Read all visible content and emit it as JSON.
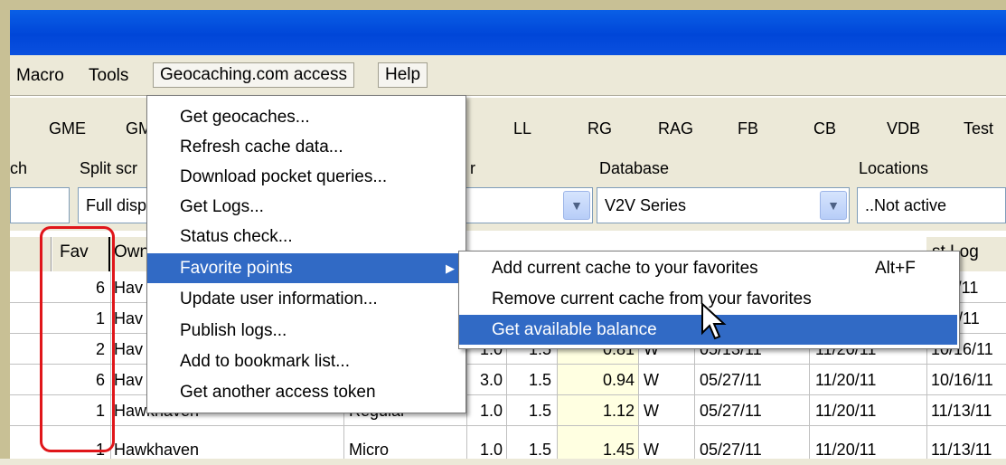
{
  "menubar": {
    "items": [
      "Macro",
      "Tools",
      "Geocaching.com access",
      "Help"
    ]
  },
  "toolbar": {
    "buttons": [
      "GME",
      "GM",
      "LL",
      "RG",
      "RAG",
      "FB",
      "CB",
      "VDB",
      "Test"
    ]
  },
  "filters": {
    "label_left": "ch",
    "split_label": "Split scr",
    "split_value": "Full disp",
    "filter_label_frag": "r",
    "database_label": "Database",
    "database_value": "V2V Series",
    "locations_label": "Locations",
    "locations_value": "..Not active"
  },
  "grid": {
    "headers": [
      "Fav",
      "Own",
      "",
      "",
      "",
      "",
      "",
      "",
      "",
      "st Log"
    ],
    "rows": [
      {
        "fav": "6",
        "owner": "Hav",
        "last": "11/11"
      },
      {
        "fav": "1",
        "owner": "Hav",
        "last": "16/11"
      },
      {
        "fav": "2",
        "owner": "Hav",
        "type": "",
        "d": "1.0",
        "t": "1.5",
        "dist": "0.81",
        "dir": "W",
        "placed": "05/13/11",
        "found": "11/20/11",
        "last": "10/16/11"
      },
      {
        "fav": "6",
        "owner": "Hav",
        "type": "",
        "d": "3.0",
        "t": "1.5",
        "dist": "0.94",
        "dir": "W",
        "placed": "05/27/11",
        "found": "11/20/11",
        "last": "10/16/11"
      },
      {
        "fav": "1",
        "owner": "Hawkhaven",
        "type": "Regular",
        "d": "1.0",
        "t": "1.5",
        "dist": "1.12",
        "dir": "W",
        "placed": "05/27/11",
        "found": "11/20/11",
        "last": "11/13/11"
      },
      {
        "fav": "1",
        "owner": "Hawkhaven",
        "type": "Micro",
        "d": "1.0",
        "t": "1.5",
        "dist": "1.45",
        "dir": "W",
        "placed": "05/27/11",
        "found": "11/20/11",
        "last": "11/13/11"
      }
    ]
  },
  "geocaching_menu": {
    "items": [
      "Get geocaches...",
      "Refresh cache data...",
      "Download pocket queries...",
      "Get Logs...",
      "Status check...",
      "Favorite points",
      "Update user information...",
      "Publish logs...",
      "Add to bookmark list...",
      "Get another access token"
    ]
  },
  "favorite_submenu": {
    "items": [
      {
        "label": "Add current cache to your favorites",
        "shortcut": "Alt+F"
      },
      {
        "label": "Remove current cache from your favorites",
        "shortcut": ""
      },
      {
        "label": "Get available balance",
        "shortcut": ""
      }
    ]
  },
  "colors": {
    "highlight": "#316ac5",
    "title_bar": "#0046d8",
    "annotation": "#e0161a"
  }
}
